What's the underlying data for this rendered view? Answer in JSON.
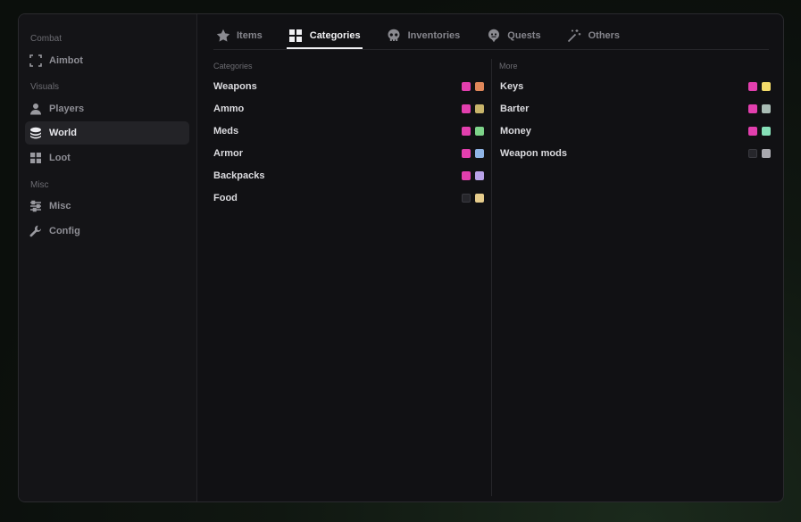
{
  "sidebar": {
    "sections": [
      {
        "label": "Combat"
      },
      {
        "label": "Visuals"
      },
      {
        "label": "Misc"
      }
    ],
    "items": [
      {
        "label": "Aimbot",
        "icon": "crosshair-frame-icon"
      },
      {
        "label": "Players",
        "icon": "person-icon"
      },
      {
        "label": "World",
        "icon": "layers-icon",
        "active": true
      },
      {
        "label": "Loot",
        "icon": "grid-icon"
      },
      {
        "label": "Misc",
        "icon": "sliders-icon"
      },
      {
        "label": "Config",
        "icon": "wrench-icon"
      }
    ]
  },
  "tabs": [
    {
      "label": "Items",
      "icon": "star-icon"
    },
    {
      "label": "Categories",
      "icon": "grid-icon",
      "active": true
    },
    {
      "label": "Inventories",
      "icon": "skull-icon"
    },
    {
      "label": "Quests",
      "icon": "marker-icon"
    },
    {
      "label": "Others",
      "icon": "wand-icon"
    }
  ],
  "left_column": {
    "heading": "Categories",
    "rows": [
      {
        "label": "Weapons",
        "enabled": true,
        "enabled_color": "#e23fae",
        "color": "#e0875a"
      },
      {
        "label": "Ammo",
        "enabled": true,
        "enabled_color": "#e23fae",
        "color": "#c8b46a"
      },
      {
        "label": "Meds",
        "enabled": true,
        "enabled_color": "#e23fae",
        "color": "#7ed48a"
      },
      {
        "label": "Armor",
        "enabled": true,
        "enabled_color": "#e23fae",
        "color": "#8fb4e6"
      },
      {
        "label": "Backpacks",
        "enabled": true,
        "enabled_color": "#e23fae",
        "color": "#b9a2e8"
      },
      {
        "label": "Food",
        "enabled": false,
        "enabled_color": "#26262b",
        "color": "#e6cc8c"
      }
    ]
  },
  "right_column": {
    "heading": "More",
    "rows": [
      {
        "label": "Keys",
        "enabled": true,
        "enabled_color": "#e23fae",
        "color": "#f2da6a"
      },
      {
        "label": "Barter",
        "enabled": true,
        "enabled_color": "#e23fae",
        "color": "#a9bcb4"
      },
      {
        "label": "Money",
        "enabled": true,
        "enabled_color": "#e23fae",
        "color": "#86e0b8"
      },
      {
        "label": "Weapon mods",
        "enabled": false,
        "enabled_color": "#26262b",
        "color": "#a8a8ae"
      }
    ]
  }
}
